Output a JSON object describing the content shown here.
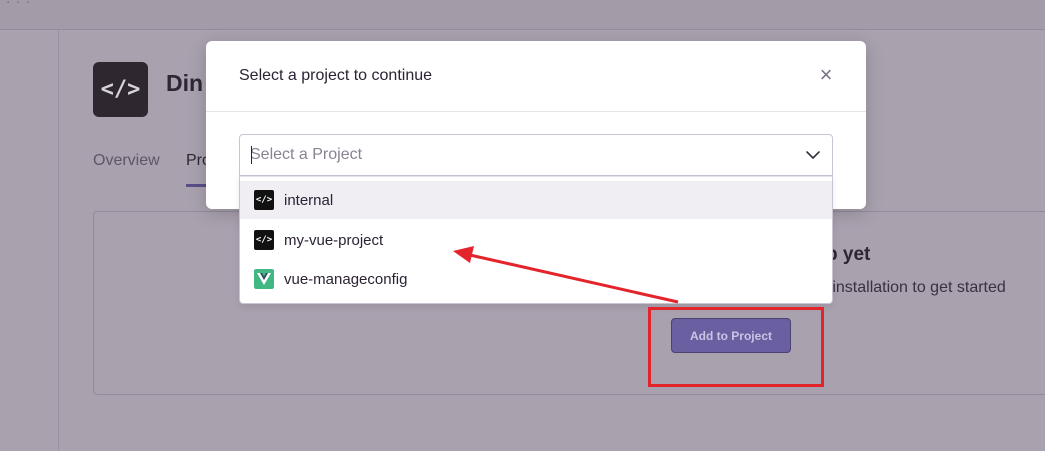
{
  "background": {
    "topbar_text": "· · ·",
    "app_icon_glyph": "</>",
    "app_title": "Din",
    "tabs": [
      {
        "label": "Overview"
      },
      {
        "label": "Pro"
      }
    ],
    "empty_state": {
      "title": "p yet",
      "description": "n installation to get started"
    },
    "add_button_label": "Add to Project"
  },
  "modal": {
    "title": "Select a project to continue",
    "close_glyph": "×",
    "select": {
      "placeholder": "Select a Project",
      "value": ""
    },
    "options": [
      {
        "label": "internal",
        "icon": "code-icon"
      },
      {
        "label": "my-vue-project",
        "icon": "code-icon"
      },
      {
        "label": "vue-manageconfig",
        "icon": "vue-logo-icon"
      }
    ],
    "code_glyph": "</>"
  },
  "colors": {
    "accent": "#6a5fa0",
    "annotation": "#e3242b",
    "vue_green": "#41b883",
    "vue_dark": "#35495e"
  }
}
